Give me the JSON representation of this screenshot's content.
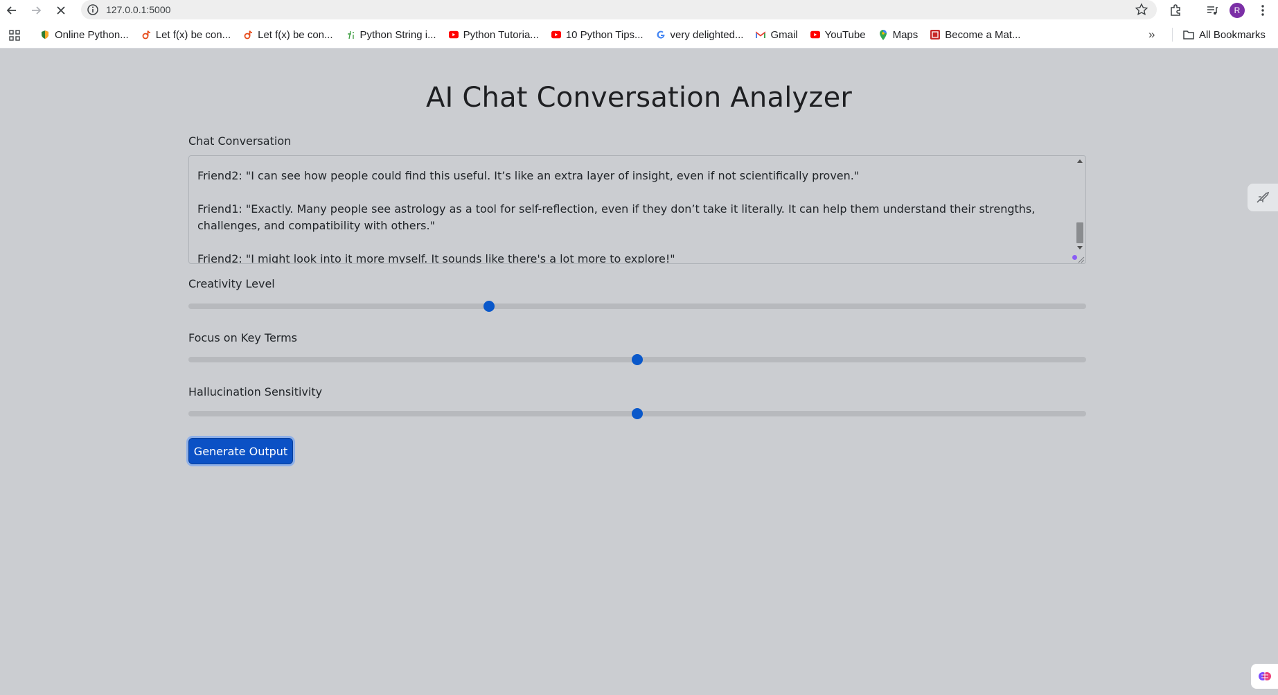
{
  "browser": {
    "url": "127.0.0.1:5000",
    "avatar_letter": "R",
    "bookmarks": [
      {
        "label": "Online Python...",
        "icon": "shield-icon"
      },
      {
        "label": "Let f(x) be con...",
        "icon": "tiktok-icon"
      },
      {
        "label": "Let f(x) be con...",
        "icon": "tiktok-icon"
      },
      {
        "label": "Python String i...",
        "icon": "fi-icon"
      },
      {
        "label": "Python Tutoria...",
        "icon": "youtube-icon"
      },
      {
        "label": "10 Python Tips...",
        "icon": "youtube-icon"
      },
      {
        "label": "very delighted...",
        "icon": "google-icon"
      },
      {
        "label": "Gmail",
        "icon": "gmail-icon"
      },
      {
        "label": "YouTube",
        "icon": "youtube-icon"
      },
      {
        "label": "Maps",
        "icon": "maps-icon"
      },
      {
        "label": "Become a Mat...",
        "icon": "bookmark-red-icon"
      }
    ],
    "more_label": "»",
    "all_bookmarks_label": "All Bookmarks"
  },
  "page": {
    "title": "AI Chat Conversation Analyzer",
    "chat_label": "Chat Conversation",
    "chat_lines": [
      "Friend2: \"I can see how people could find this useful. It’s like an extra layer of insight, even if not scientifically proven.\"",
      "Friend1: \"Exactly. Many people see astrology as a tool for self-reflection, even if they don’t take it literally. It can help them understand their strengths, challenges, and compatibility with others.\"",
      "Friend2: \"I might look into it more myself. It sounds like there's a lot more to explore!\""
    ],
    "sliders": [
      {
        "label": "Creativity Level",
        "value_fraction": 0.335
      },
      {
        "label": "Focus on Key Terms",
        "value_fraction": 0.5
      },
      {
        "label": "Hallucination Sensitivity",
        "value_fraction": 0.5
      }
    ],
    "generate_label": "Generate Output"
  },
  "colors": {
    "page_bg": "#cbcdd1",
    "accent": "#0b51c5",
    "slider_thumb": "#0a58ca"
  }
}
